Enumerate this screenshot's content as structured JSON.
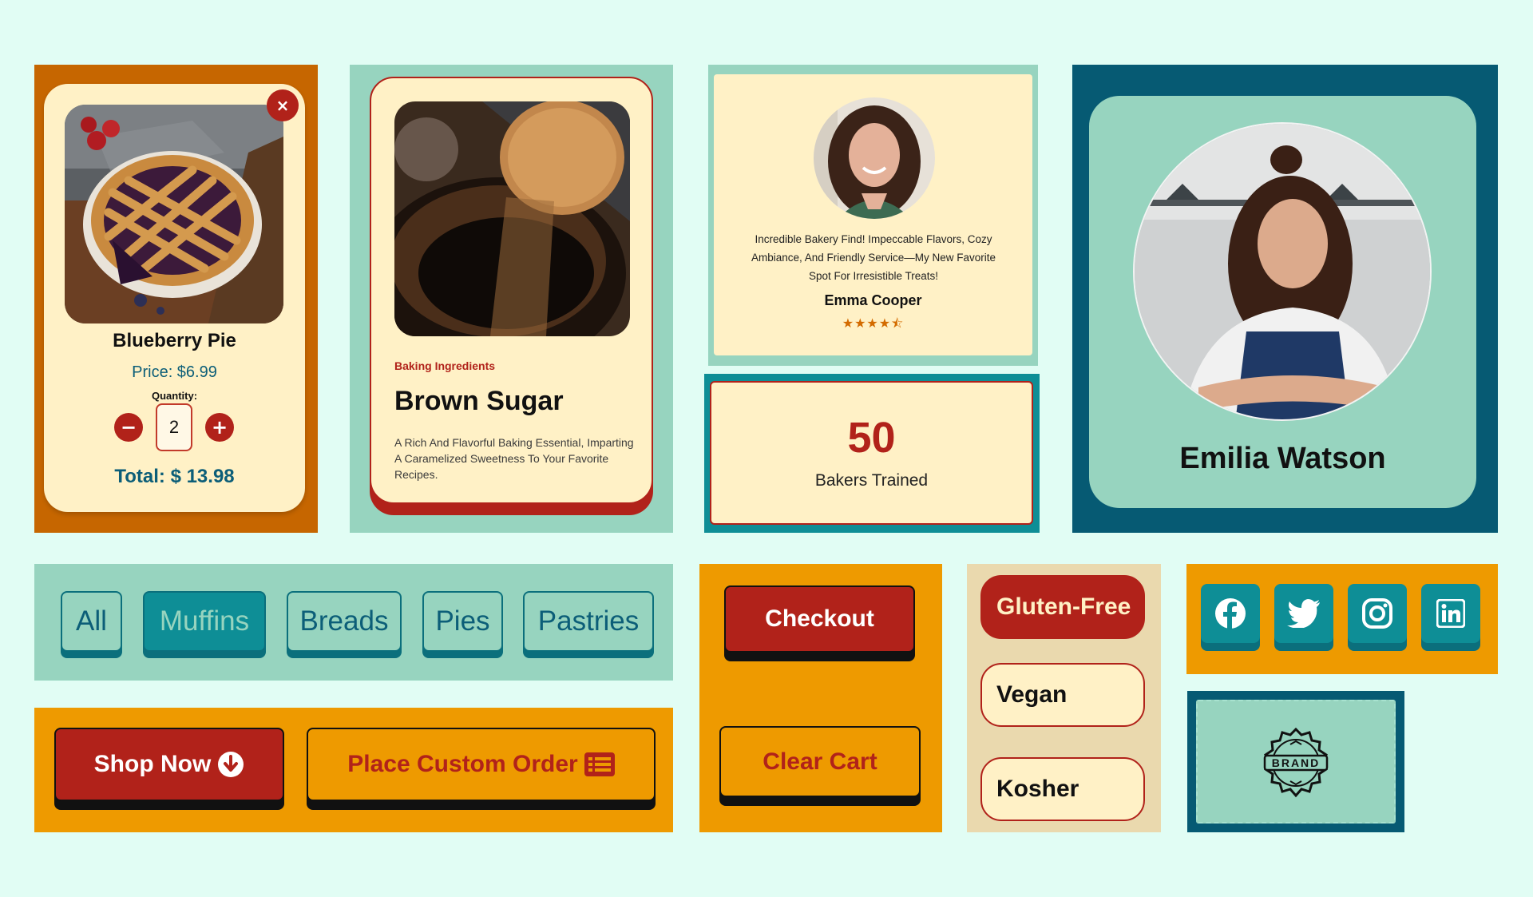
{
  "product_card": {
    "title": "Blueberry Pie",
    "price": "Price: $6.99",
    "quantity_label": "Quantity:",
    "quantity_value": "2",
    "total": "Total: $ 13.98",
    "minus_symbol": "−",
    "plus_symbol": "+",
    "close_symbol": "×"
  },
  "ingredient_card": {
    "category": "Baking Ingredients",
    "title": "Brown Sugar",
    "description": "A Rich And Flavorful Baking Essential, Imparting A Caramelized Sweetness To Your Favorite Recipes."
  },
  "testimonial": {
    "text": "Incredible Bakery Find! Impeccable Flavors, Cozy Ambiance, And Friendly Service—My New Favorite Spot For Irresistible Treats!",
    "name": "Emma Cooper",
    "rating": 4.5,
    "stars": "★★★★⯪"
  },
  "stat": {
    "number": "50",
    "label": "Bakers Trained"
  },
  "profile": {
    "name": "Emilia Watson"
  },
  "filters": {
    "items": [
      "All",
      "Muffins",
      "Breads",
      "Pies",
      "Pastries"
    ],
    "active": "Muffins"
  },
  "actions": {
    "shop_now": "Shop Now",
    "custom_order": "Place Custom Order",
    "checkout": "Checkout",
    "clear_cart": "Clear Cart"
  },
  "tags": {
    "items": [
      "Gluten-Free",
      "Vegan",
      "Kosher"
    ],
    "active": "Gluten-Free"
  },
  "social": {
    "icons": [
      "facebook-icon",
      "twitter-icon",
      "instagram-icon",
      "linkedin-icon"
    ]
  },
  "brand": {
    "logo_text": "BRAND"
  },
  "colors": {
    "background": "#e1fdf4",
    "brand_red": "#b1221a",
    "teal": "#0e8e96",
    "dark_teal": "#065a73",
    "mint": "#97d4bf",
    "cream": "#fff1c6",
    "orange": "#ee9a00",
    "burnt_orange": "#c66600"
  }
}
